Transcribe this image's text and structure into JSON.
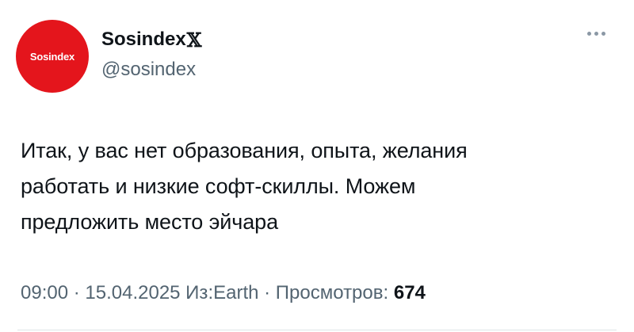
{
  "author": {
    "display_name": "Sosindex",
    "verified_glyph": "𝕏",
    "handle": "@sosindex",
    "avatar_text": "Sosindex",
    "avatar_color": "#e4151c"
  },
  "more_icon": "more-horizontal-icon",
  "tweet": {
    "text": "Итак, у вас нет образования, опыта, желания\nработать и низкие софт-скиллы. Можем\nпредложить место эйчара"
  },
  "meta": {
    "time": "09:00",
    "sep1": " · ",
    "date": "15.04.2025",
    "source": " Из:Earth",
    "sep2": " · ",
    "views_label": "Просмотров: ",
    "views_count": "674"
  }
}
